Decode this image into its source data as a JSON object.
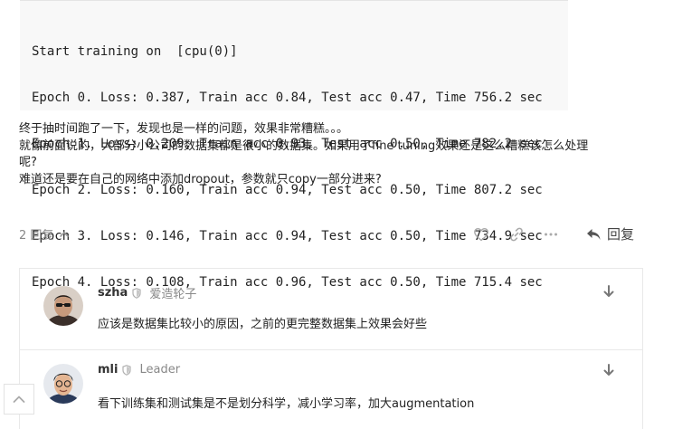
{
  "code": {
    "lines": [
      "Start training on  [cpu(0)]",
      "Epoch 0. Loss: 0.387, Train acc 0.84, Test acc 0.47, Time 756.2 sec",
      "Epoch 1. Loss: 0.209, Train acc 0.93, Test acc 0.50, Time 782.2 sec",
      "Epoch 2. Loss: 0.160, Train acc 0.94, Test acc 0.50, Time 807.2 sec",
      "Epoch 3. Loss: 0.146, Train acc 0.94, Test acc 0.50, Time 734.9 sec",
      "Epoch 4. Loss: 0.108, Train acc 0.96, Test acc 0.50, Time 715.4 sec"
    ]
  },
  "post": {
    "paragraph1": "终于抽时间跑了一下，发现也是一样的问题，效果非常糟糕。。。",
    "paragraph2_line1": "就像前面说的，大部分小公司的数据集都是很小的数据集。如果用了fine tuning效果还是这么糟糕该怎么处理",
    "paragraph2_line2": "呢?",
    "paragraph3": "难道还是要在自己的网络中添加dropout，参数就只copy一部分进来?"
  },
  "actions": {
    "reply_count": "2 回复",
    "reply_label": "回复",
    "icons": [
      "heart-icon",
      "link-icon",
      "more-icon",
      "reply-arrow-icon"
    ]
  },
  "replies": [
    {
      "username": "szha",
      "user_title": "爱造轮子",
      "text": "应该是数据集比较小的原因，之前的更完整数据集上效果会好些"
    },
    {
      "username": "mli",
      "user_title": "Leader",
      "text": "看下训练集和测试集是不是划分科学，减小学习率，加大augmentation"
    }
  ],
  "colors": {
    "muted": "#888888",
    "border": "#e9e9e9",
    "code_bg": "#f8f8f8"
  }
}
